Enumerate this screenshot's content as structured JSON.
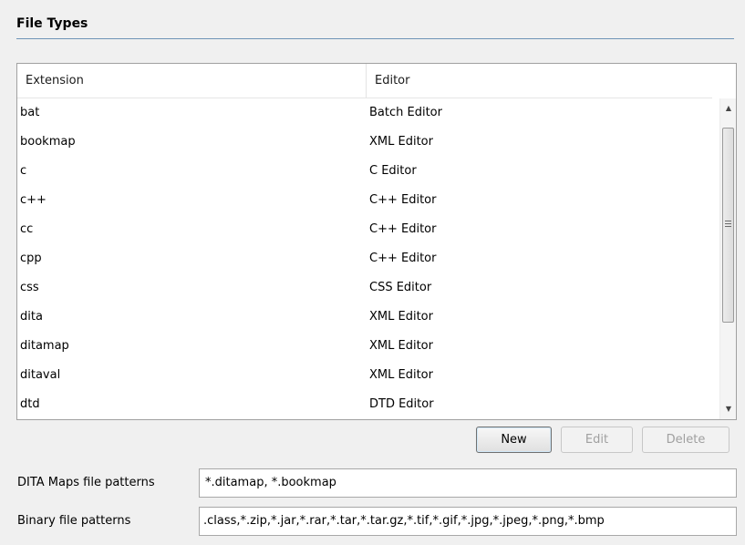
{
  "section": {
    "title": "File Types"
  },
  "table": {
    "columns": [
      "Extension",
      "Editor"
    ],
    "rows": [
      {
        "extension": "bat",
        "editor": "Batch Editor"
      },
      {
        "extension": "bookmap",
        "editor": "XML Editor"
      },
      {
        "extension": "c",
        "editor": "C Editor"
      },
      {
        "extension": "c++",
        "editor": "C++ Editor"
      },
      {
        "extension": "cc",
        "editor": "C++ Editor"
      },
      {
        "extension": "cpp",
        "editor": "C++ Editor"
      },
      {
        "extension": "css",
        "editor": "CSS Editor"
      },
      {
        "extension": "dita",
        "editor": "XML Editor"
      },
      {
        "extension": "ditamap",
        "editor": "XML Editor"
      },
      {
        "extension": "ditaval",
        "editor": "XML Editor"
      },
      {
        "extension": "dtd",
        "editor": "DTD Editor"
      }
    ]
  },
  "scrollbar": {
    "up_icon": "triangle-up",
    "down_icon": "triangle-down",
    "grip_icon": "grip-lines"
  },
  "buttons": {
    "new_label": "New",
    "edit_label": "Edit",
    "delete_label": "Delete",
    "edit_enabled": false,
    "delete_enabled": false
  },
  "fields": {
    "dita_maps": {
      "label": "DITA Maps file patterns",
      "value": "*.ditamap, *.bookmap"
    },
    "binary": {
      "label": "Binary file patterns",
      "value": ".class,*.zip,*.jar,*.rar,*.tar,*.tar.gz,*.tif,*.gif,*.jpg,*.jpeg,*.png,*.bmp"
    }
  },
  "colors": {
    "accent_rule": "#6e94b7",
    "disabled_text": "#a0a0a0",
    "background": "#f0f0f0"
  }
}
